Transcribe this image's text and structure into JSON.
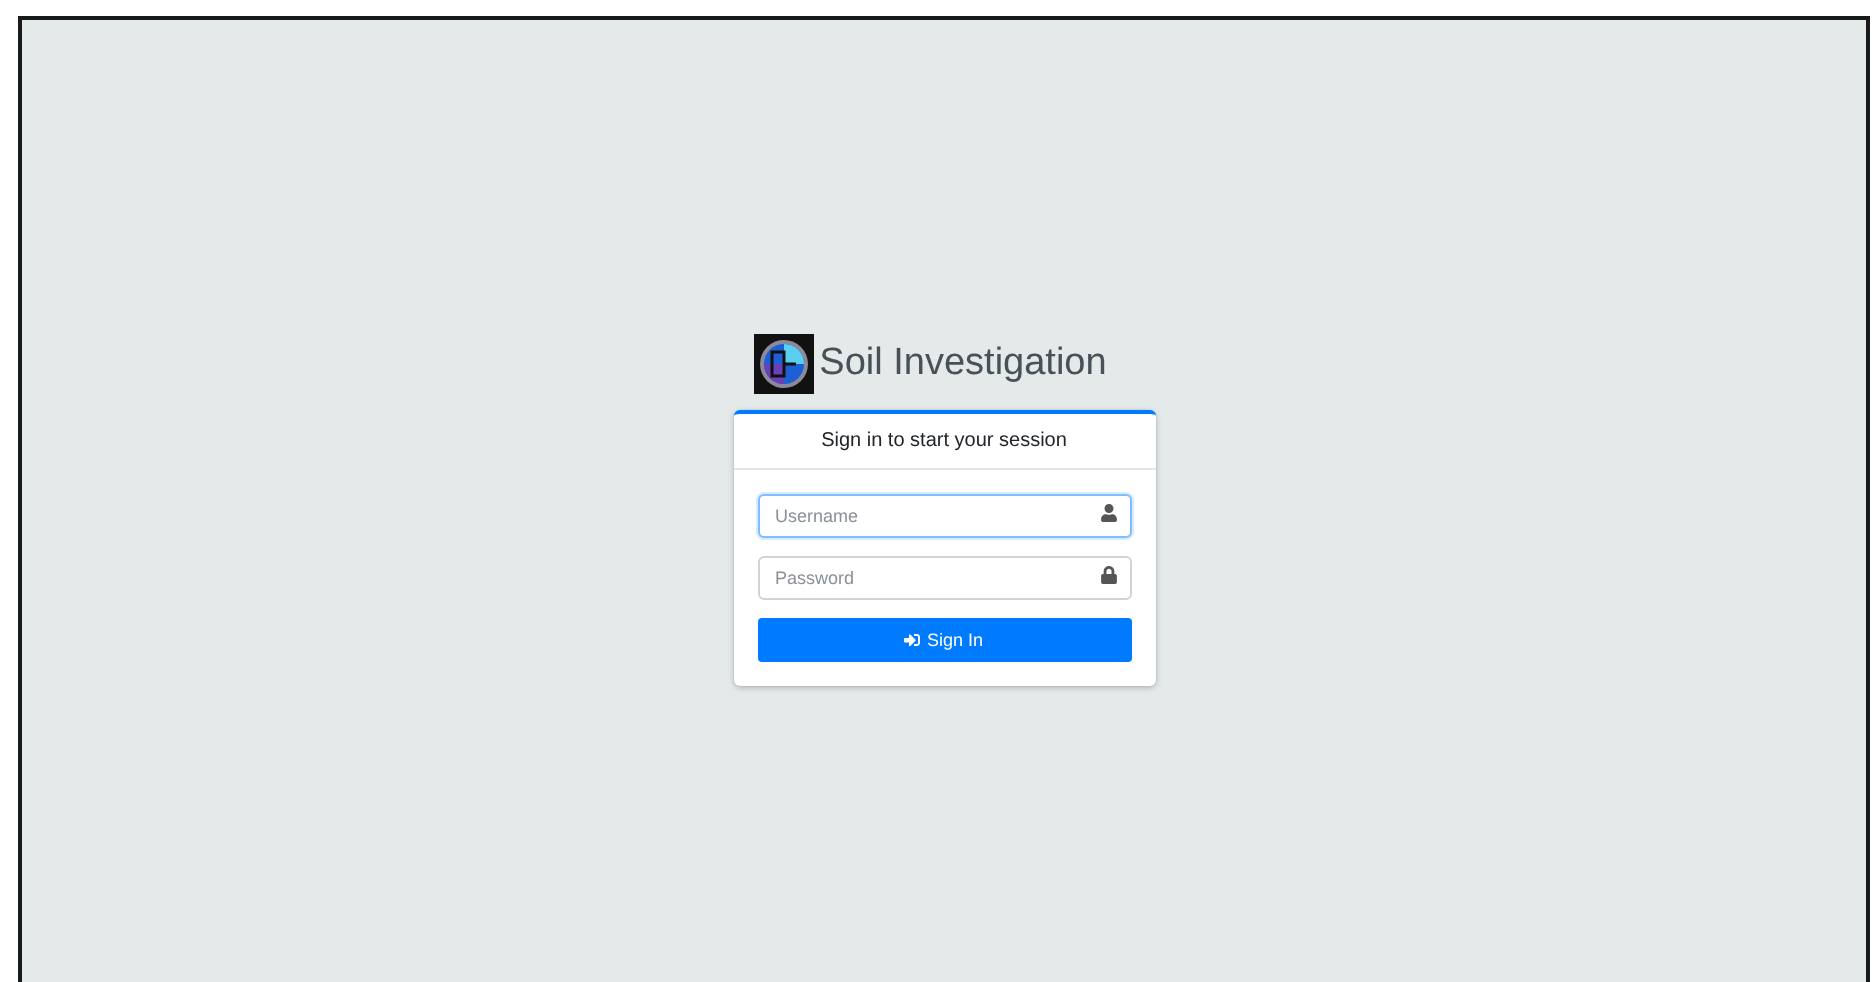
{
  "brand": {
    "title": "Soil Investigation"
  },
  "login_box": {
    "message": "Sign in to start your session",
    "fields": [
      {
        "kind": "text",
        "placeholder": "Username",
        "focused": true
      },
      {
        "kind": "password",
        "placeholder": "Password",
        "focused": false
      }
    ],
    "button": {
      "label": "Sign In"
    }
  }
}
